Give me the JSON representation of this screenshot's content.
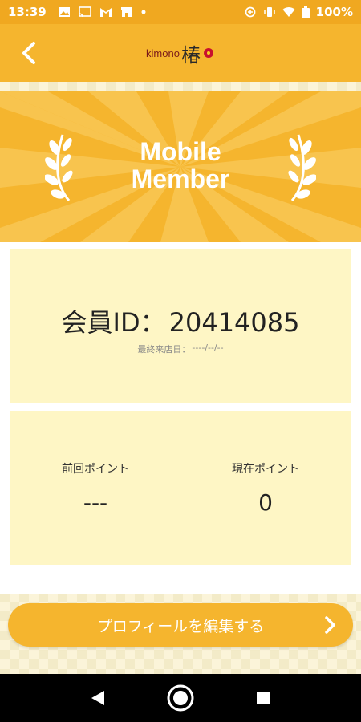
{
  "status_bar": {
    "time": "13:39",
    "battery": "100%",
    "left_icons": [
      "image-icon",
      "cast-icon",
      "gmail-icon",
      "store-icon",
      "dot-icon"
    ],
    "right_icons": [
      "data-saver-icon",
      "vibrate-icon",
      "wifi-icon",
      "battery-icon"
    ]
  },
  "app_bar": {
    "logo_text": "kimono",
    "logo_kanji": "椿",
    "back_icon": "chevron-left-icon"
  },
  "banner": {
    "title_line1": "Mobile",
    "title_line2": "Member"
  },
  "member_card": {
    "id_label": "会員ID：",
    "id_value": "20414085",
    "last_visit_label": "最終来店日：",
    "last_visit_value": "----/--/--"
  },
  "points": {
    "previous_label": "前回ポイント",
    "previous_value": "---",
    "current_label": "現在ポイント",
    "current_value": "0"
  },
  "edit_profile": {
    "label": "プロフィールを編集する",
    "icon": "chevron-right-icon"
  },
  "colors": {
    "primary": "#f5b52e",
    "status_bar": "#f0a820",
    "card_bg": "#fef6c5",
    "page_bg": "#fbf4d9"
  },
  "nav_bar": {
    "icons": [
      "back-triangle-icon",
      "home-circle-icon",
      "recents-square-icon"
    ]
  }
}
